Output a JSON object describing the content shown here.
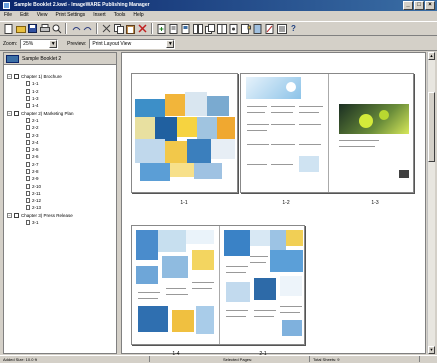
{
  "window": {
    "title": "Sample Booklet 2.kwd - ImageWARE Publishing Manager"
  },
  "menu": [
    "File",
    "Edit",
    "View",
    "Print Settings",
    "Insert",
    "Tools",
    "Help"
  ],
  "zoom": {
    "label": "Zoom:",
    "value": "25%"
  },
  "preview": {
    "label": "Preview:",
    "value": "Print Layout View"
  },
  "tree": {
    "root": "Sample Booklet 2",
    "chapters": [
      {
        "title": "Chapter 1) Brochure",
        "pages": [
          "1-1",
          "1-2",
          "1-3",
          "1-4"
        ]
      },
      {
        "title": "Chapter 2) Marketing Plan",
        "pages": [
          "2-1",
          "2-2",
          "2-3",
          "2-4",
          "2-5",
          "2-6",
          "2-7",
          "2-8",
          "2-9",
          "2-10",
          "2-11",
          "2-12",
          "2-13"
        ]
      },
      {
        "title": "Chapter 3) Press Release",
        "pages": [
          "3-1"
        ]
      }
    ]
  },
  "preview_pages": {
    "labels": [
      "1-1",
      "1-2",
      "1-3",
      "1-4",
      "2-1"
    ]
  },
  "status": {
    "left": "Added Size: 10.0 ft",
    "mid": "Selected Pages:",
    "right": "Total Sheets: 9"
  },
  "icons": [
    "new-icon",
    "open-icon",
    "save-icon",
    "print-icon",
    "undo-icon",
    "redo-icon"
  ],
  "colors": {
    "titlebar": "#0a246a",
    "panel": "#d4d0c8"
  }
}
